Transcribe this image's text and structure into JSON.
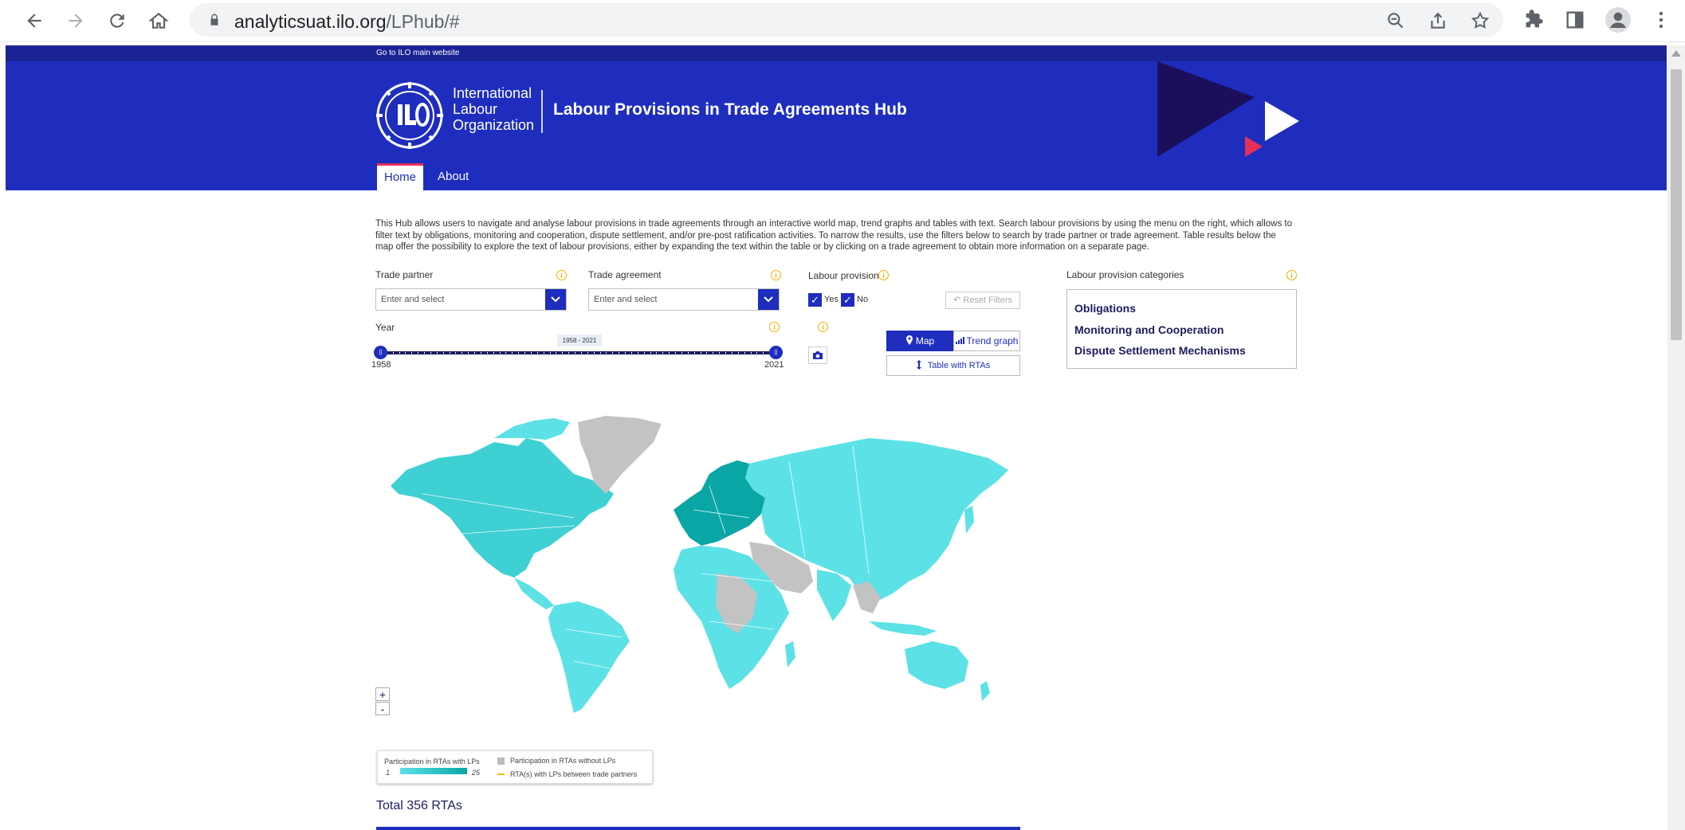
{
  "browser": {
    "url_host": "analyticsuat.ilo.org",
    "url_path": "/LPhub/#"
  },
  "site": {
    "top_link": "Go to ILO main website",
    "org_name_line1": "International",
    "org_name_line2": "Labour",
    "org_name_line3": "Organization",
    "hub_title": "Labour Provisions in Trade Agreements Hub",
    "tabs": [
      {
        "label": "Home",
        "active": true
      },
      {
        "label": "About",
        "active": false
      }
    ]
  },
  "intro_text": "This Hub allows users to navigate and analyse labour provisions in trade agreements through an interactive world map, trend graphs and tables with text. Search labour provisions by using the menu on the right, which allows to filter text by obligations, monitoring and cooperation, dispute settlement, and/or pre-post ratification activities. To narrow the results, use the filters below to search by trade partner or trade agreement. Table results below the map offer the possibility to explore the text of labour provisions, either by expanding the text within the table or by clicking on a trade agreement to obtain more information on a separate page.",
  "filters": {
    "trade_partner_label": "Trade partner",
    "trade_partner_placeholder": "Enter and select",
    "trade_agreement_label": "Trade agreement",
    "trade_agreement_placeholder": "Enter and select",
    "labour_provision_label": "Labour provision",
    "yes_label": "Yes",
    "no_label": "No",
    "reset_label": "Reset Filters",
    "year_label": "Year",
    "year_min": "1958",
    "year_max": "2021",
    "year_range_bubble": "1958 - 2021",
    "slider_fraction_start": 0,
    "slider_fraction_end": 1
  },
  "view_buttons": {
    "map": "Map",
    "trend": "Trend graph",
    "table": "Table with RTAs"
  },
  "categories": {
    "label": "Labour provision categories",
    "items": [
      "Obligations",
      "Monitoring and Cooperation",
      "Dispute Settlement Mechanisms"
    ]
  },
  "map_controls": {
    "zoom_in": "+",
    "zoom_out": "-"
  },
  "legend": {
    "with_lps": "Participation in RTAs with LPs",
    "min": "1",
    "max": "25",
    "without_lps": "Participation in RTAs without LPs",
    "between_partners": "RTA(s) with LPs between trade partners"
  },
  "colors": {
    "brand_blue": "#1e2dbe",
    "dark_navy": "#1a2394",
    "map_light": "#5ce1e6",
    "map_dark": "#0aa6a6",
    "map_grey": "#c3c3c3",
    "accent_red": "#e6305c"
  },
  "total_text": "Total 356 RTAs"
}
